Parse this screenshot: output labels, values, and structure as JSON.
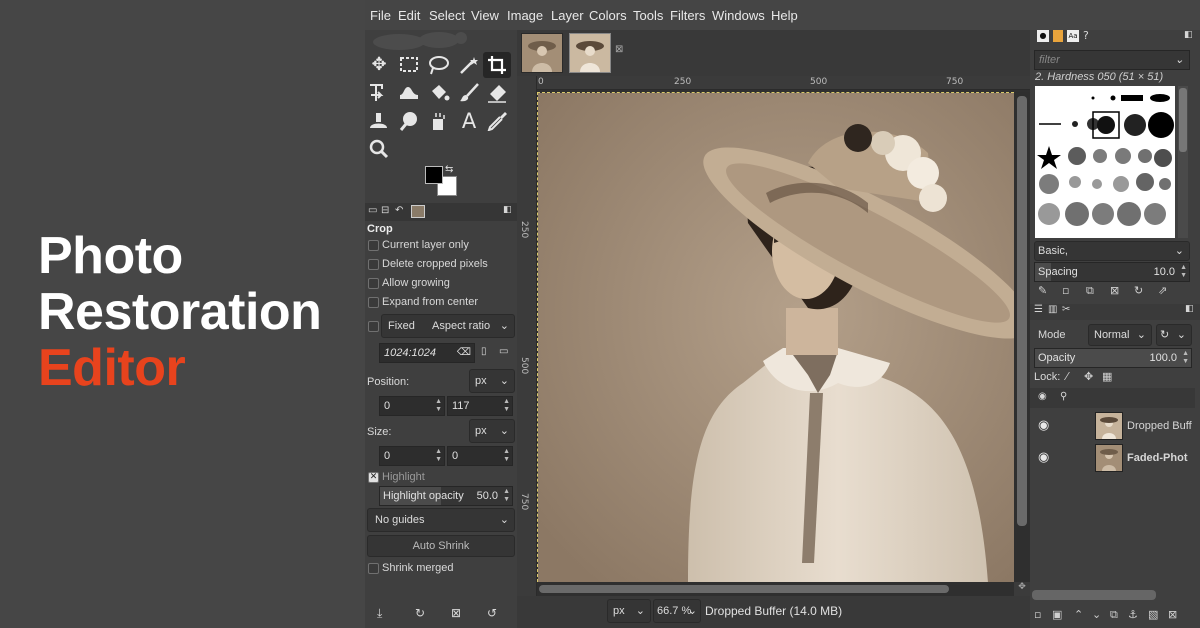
{
  "promo": {
    "line1": "Photo",
    "line2": "Restoration",
    "line3": "Editor",
    "accent_color": "#e8431d",
    "text_color": "#ffffff"
  },
  "menubar": {
    "items": [
      "File",
      "Edit",
      "Select",
      "View",
      "Image",
      "Layer",
      "Colors",
      "Tools",
      "Filters",
      "Windows",
      "Help"
    ]
  },
  "toolbox": {
    "tools": [
      "move-icon",
      "rect-select-icon",
      "lasso-icon",
      "fuzzy-select-icon",
      "crop-icon",
      "transform-icon",
      "warp-icon",
      "bucket-fill-icon",
      "paintbrush-icon",
      "eraser-icon",
      "clone-icon",
      "smudge-icon",
      "dodge-icon",
      "text-icon",
      "color-picker-icon",
      "zoom-icon"
    ],
    "active_tool": "crop-icon",
    "fg_color": "#000000",
    "bg_color": "#ffffff"
  },
  "tool_options": {
    "title": "Crop",
    "current_layer_only": "Current layer only",
    "delete_cropped": "Delete cropped pixels",
    "allow_growing": "Allow growing",
    "expand_center": "Expand from center",
    "fixed_label": "Fixed",
    "fixed_mode": "Aspect ratio",
    "ratio_value": "1024:1024",
    "position_label": "Position:",
    "position_unit": "px",
    "position_x": "0",
    "position_y": "117",
    "size_label": "Size:",
    "size_unit": "px",
    "size_w": "0",
    "size_h": "0",
    "highlight": "Highlight",
    "highlight_opacity_label": "Highlight opacity",
    "highlight_opacity_value": "50.0",
    "guides": "No guides",
    "auto_shrink": "Auto Shrink",
    "shrink_merged": "Shrink merged"
  },
  "canvas": {
    "ruler_h": [
      "0",
      "250",
      "500",
      "750"
    ],
    "ruler_v": [
      "250",
      "500",
      "750"
    ],
    "unit": "px",
    "zoom": "66.7 %",
    "status": "Dropped Buffer (14.0 MB)"
  },
  "brushes": {
    "filter_placeholder": "filter",
    "current": "2. Hardness 050 (51 × 51)",
    "preset": "Basic,",
    "spacing_label": "Spacing",
    "spacing_value": "10.0"
  },
  "layers": {
    "mode_label": "Mode",
    "mode_value": "Normal",
    "opacity_label": "Opacity",
    "opacity_value": "100.0",
    "lock_label": "Lock:",
    "items": [
      {
        "name": "Dropped Buff",
        "bold": false
      },
      {
        "name": "Faded-Phot",
        "bold": true
      }
    ]
  }
}
